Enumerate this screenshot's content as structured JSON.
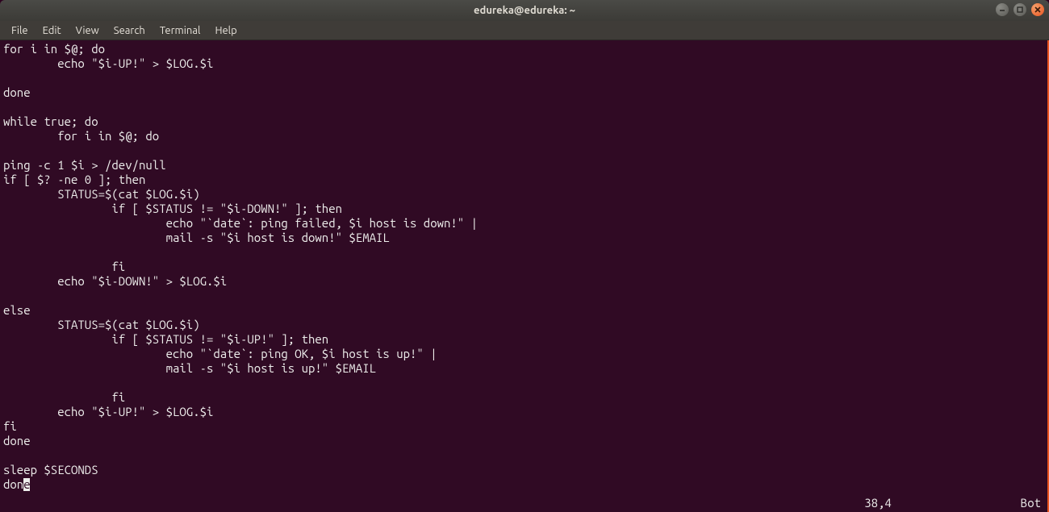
{
  "titlebar": {
    "title": "edureka@edureka: ~"
  },
  "menubar": {
    "items": [
      "File",
      "Edit",
      "View",
      "Search",
      "Terminal",
      "Help"
    ]
  },
  "terminal": {
    "lines": [
      "for i in $@; do",
      "        echo \"$i-UP!\" > $LOG.$i",
      "",
      "done",
      "",
      "while true; do",
      "        for i in $@; do",
      "",
      "ping -c 1 $i > /dev/null",
      "if [ $? -ne 0 ]; then",
      "        STATUS=$(cat $LOG.$i)",
      "                if [ $STATUS != \"$i-DOWN!\" ]; then",
      "                        echo \"`date`: ping failed, $i host is down!\" |",
      "                        mail -s \"$i host is down!\" $EMAIL",
      "",
      "                fi",
      "        echo \"$i-DOWN!\" > $LOG.$i",
      "",
      "else",
      "        STATUS=$(cat $LOG.$i)",
      "                if [ $STATUS != \"$i-UP!\" ]; then",
      "                        echo \"`date`: ping OK, $i host is up!\" |",
      "                        mail -s \"$i host is up!\" $EMAIL",
      "",
      "                fi",
      "        echo \"$i-UP!\" > $LOG.$i",
      "fi",
      "done",
      "",
      "sleep $SECONDS"
    ],
    "last_line_prefix": "don",
    "last_line_cursor_char": "e",
    "status_position": "38,4",
    "status_percent": "Bot"
  }
}
